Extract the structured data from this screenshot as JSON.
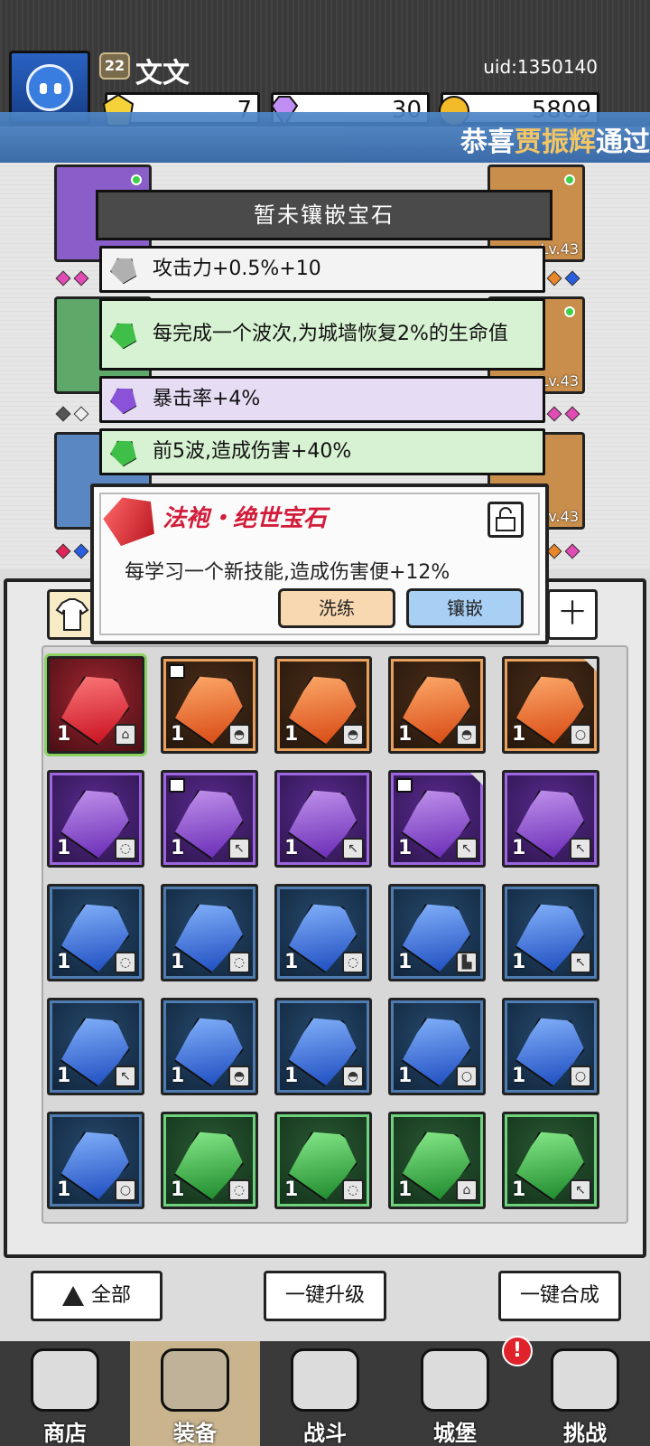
{
  "header": {
    "level": "22",
    "player_name": "文文",
    "uid": "uid:1350140",
    "resources": [
      {
        "icon": "yellow-gem-icon",
        "value": "7"
      },
      {
        "icon": "purple-diamond-icon",
        "value": "30"
      },
      {
        "icon": "gold-coin-icon",
        "value": "5809"
      }
    ],
    "ticker": {
      "prefix": "恭喜",
      "highlight": "贾振辉",
      "suffix": "通过"
    }
  },
  "equipment": {
    "left_slots": [
      {
        "color": "purple",
        "level": ""
      },
      {
        "color": "green",
        "level": ""
      },
      {
        "color": "blue",
        "level": ""
      }
    ],
    "right_slots": [
      {
        "color": "orange",
        "level": "Lv.43"
      },
      {
        "color": "orange",
        "level": "Lv.43"
      },
      {
        "color": "orange",
        "level": "Lv.43"
      }
    ]
  },
  "stats_panel": {
    "title": "暂未镶嵌宝石",
    "stats": [
      {
        "gem": "gray",
        "text": "攻击力+0.5%+10"
      },
      {
        "gem": "green",
        "text": "每完成一个波次,为城墙恢复2%的生命值"
      },
      {
        "gem": "purple",
        "text": "暴击率+4%"
      },
      {
        "gem": "green",
        "text": "前5波,造成伤害+40%"
      }
    ]
  },
  "gem_popup": {
    "title": "法袍・绝世宝石",
    "description": "每学习一个新技能,造成伤害便+12%",
    "reroll_label": "洗练",
    "embed_label": "镶嵌"
  },
  "inventory": {
    "sort_label": "十",
    "rows": [
      [
        {
          "color": "red",
          "qty": "1",
          "type": "⌂",
          "locked": false,
          "corner": false
        },
        {
          "color": "orange",
          "qty": "1",
          "type": "◓",
          "locked": true,
          "corner": false
        },
        {
          "color": "orange",
          "qty": "1",
          "type": "◓",
          "locked": false,
          "corner": false
        },
        {
          "color": "orange",
          "qty": "1",
          "type": "◓",
          "locked": false,
          "corner": false
        },
        {
          "color": "orange",
          "qty": "1",
          "type": "○",
          "locked": false,
          "corner": true
        }
      ],
      [
        {
          "color": "purple",
          "qty": "1",
          "type": "◌",
          "locked": false,
          "corner": false
        },
        {
          "color": "purple",
          "qty": "1",
          "type": "↖",
          "locked": true,
          "corner": false
        },
        {
          "color": "purple",
          "qty": "1",
          "type": "↖",
          "locked": false,
          "corner": false
        },
        {
          "color": "purple",
          "qty": "1",
          "type": "↖",
          "locked": true,
          "corner": true
        },
        {
          "color": "purple",
          "qty": "1",
          "type": "↖",
          "locked": false,
          "corner": false
        }
      ],
      [
        {
          "color": "blue",
          "qty": "1",
          "type": "◌",
          "locked": false,
          "corner": false
        },
        {
          "color": "blue",
          "qty": "1",
          "type": "◌",
          "locked": false,
          "corner": false
        },
        {
          "color": "blue",
          "qty": "1",
          "type": "◌",
          "locked": false,
          "corner": false
        },
        {
          "color": "blue",
          "qty": "1",
          "type": "▙",
          "locked": false,
          "corner": false
        },
        {
          "color": "blue",
          "qty": "1",
          "type": "↖",
          "locked": false,
          "corner": false
        }
      ],
      [
        {
          "color": "blue",
          "qty": "1",
          "type": "↖",
          "locked": false,
          "corner": false
        },
        {
          "color": "blue",
          "qty": "1",
          "type": "◓",
          "locked": false,
          "corner": false
        },
        {
          "color": "blue",
          "qty": "1",
          "type": "◓",
          "locked": false,
          "corner": false
        },
        {
          "color": "blue",
          "qty": "1",
          "type": "○",
          "locked": false,
          "corner": false
        },
        {
          "color": "blue",
          "qty": "1",
          "type": "○",
          "locked": false,
          "corner": false
        }
      ],
      [
        {
          "color": "blue",
          "qty": "1",
          "type": "○",
          "locked": false,
          "corner": false
        },
        {
          "color": "green",
          "qty": "1",
          "type": "◌",
          "locked": false,
          "corner": false
        },
        {
          "color": "green",
          "qty": "1",
          "type": "◌",
          "locked": false,
          "corner": false
        },
        {
          "color": "green",
          "qty": "1",
          "type": "⌂",
          "locked": false,
          "corner": false
        },
        {
          "color": "green",
          "qty": "1",
          "type": "↖",
          "locked": false,
          "corner": false
        }
      ]
    ]
  },
  "actions": {
    "filter_all": "全部",
    "upgrade_all": "一键升级",
    "merge_all": "一键合成"
  },
  "nav": [
    {
      "label": "商店",
      "icon": "shop-icon",
      "active": false
    },
    {
      "label": "装备",
      "icon": "backpack-icon",
      "active": true
    },
    {
      "label": "战斗",
      "icon": "crossed-swords-icon",
      "active": false
    },
    {
      "label": "城堡",
      "icon": "castle-icon",
      "active": false
    },
    {
      "label": "挑战",
      "icon": "shield-icon",
      "active": false
    }
  ],
  "alert_badge": "!"
}
